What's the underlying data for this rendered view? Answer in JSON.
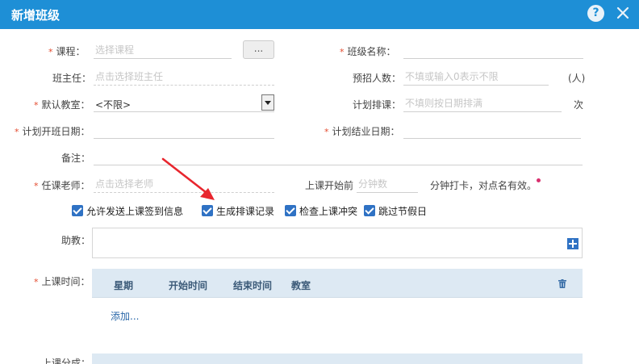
{
  "dialog": {
    "title": "新增班级"
  },
  "fields": {
    "course": {
      "label": "课程：",
      "placeholder": "选择课程",
      "button": "..."
    },
    "class_name": {
      "label": "班级名称：",
      "placeholder": ""
    },
    "head_teacher": {
      "label": "班主任：",
      "placeholder": "点击选择班主任"
    },
    "expected_count": {
      "label": "预招人数：",
      "placeholder": "不填或输入0表示不限",
      "unit": "(人)"
    },
    "default_room": {
      "label": "默认教室：",
      "value": "<不限>"
    },
    "planned_lessons": {
      "label": "计划排课：",
      "placeholder": "不填则按日期排满",
      "unit": "次"
    },
    "start_date": {
      "label": "计划开班日期：",
      "placeholder": ""
    },
    "end_date": {
      "label": "计划结业日期：",
      "placeholder": ""
    },
    "remark": {
      "label": "备注：",
      "placeholder": ""
    },
    "teacher": {
      "label": "任课老师：",
      "placeholder": "点击选择老师"
    },
    "checkin": {
      "prefix": "上课开始前",
      "placeholder": "分钟数",
      "suffix": "分钟打卡，对点名有效。"
    },
    "assistant": {
      "label": "助教："
    },
    "schedule": {
      "label": "上课时间：",
      "add_link": "添加..."
    },
    "next_section": {
      "label": "上课分成："
    }
  },
  "required_mark": "*",
  "checkboxes": [
    {
      "label": "允许发送上课签到信息",
      "checked": true
    },
    {
      "label": "生成排课记录",
      "checked": true
    },
    {
      "label": "检查上课冲突",
      "checked": true
    },
    {
      "label": "跳过节假日",
      "checked": true
    }
  ],
  "schedule_table": {
    "headers": [
      "星期",
      "开始时间",
      "结束时间",
      "教室"
    ]
  },
  "colors": {
    "titlebar": "#1e8fd6",
    "checkbox": "#2f72c4",
    "required": "#e34a2e",
    "annotation_arrow": "#e8262e"
  },
  "icons": {
    "help": "question-mark",
    "close": "x-mark",
    "add": "plus-square",
    "delete": "trash-can"
  },
  "help_glyph": "?"
}
